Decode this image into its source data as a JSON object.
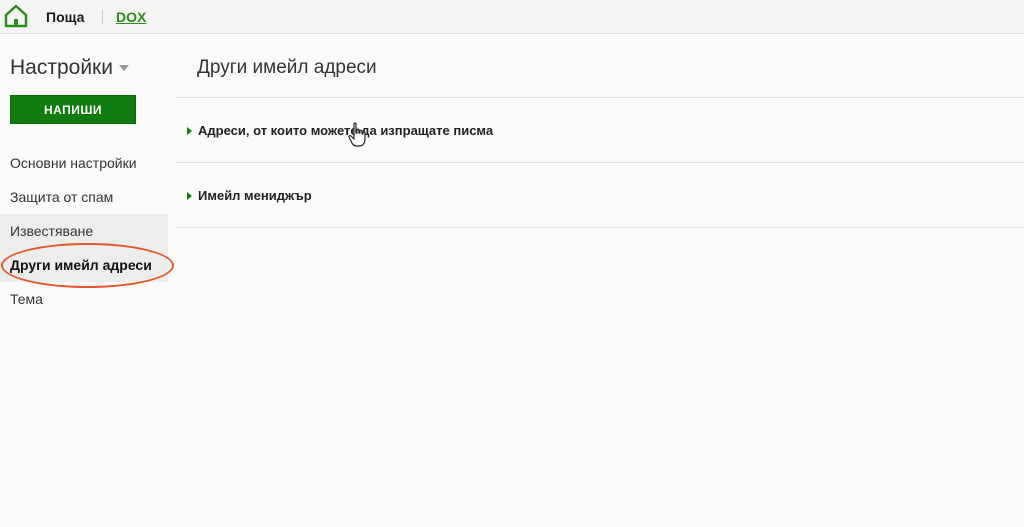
{
  "topbar": {
    "home_icon": "home-icon",
    "mail_label": "Поща",
    "dox_label": "DOX",
    "accent": "#2e8b1e"
  },
  "sidebar": {
    "title": "Настройки",
    "compose_label": "НАПИШИ",
    "items": [
      {
        "label": "Основни настройки"
      },
      {
        "label": "Защита от спам"
      },
      {
        "label": "Известяване"
      },
      {
        "label": "Други имейл адреси"
      },
      {
        "label": "Тема"
      }
    ],
    "active_index": 3,
    "compose_color": "#107c10",
    "highlight_color": "#e2572a"
  },
  "main": {
    "title": "Други имейл адреси",
    "sections": [
      {
        "label": "Адреси, от които можете да изпращате писма"
      },
      {
        "label": "Имейл мениджър"
      }
    ]
  }
}
